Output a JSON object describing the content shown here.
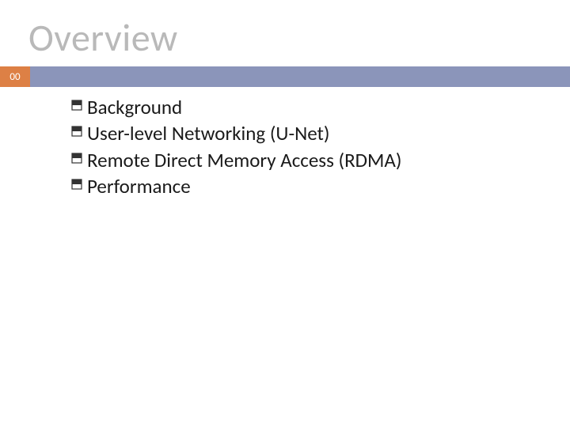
{
  "title": "Overview",
  "slide_number": "00",
  "items": [
    {
      "label": "Background"
    },
    {
      "label": "User-level Networking (U-Net)"
    },
    {
      "label": "Remote Direct Memory Access (RDMA)"
    },
    {
      "label": "Performance"
    }
  ],
  "colors": {
    "title_grey": "#b9b9b9",
    "accent_orange": "#dd8045",
    "bar_blue": "#8b95ba"
  }
}
